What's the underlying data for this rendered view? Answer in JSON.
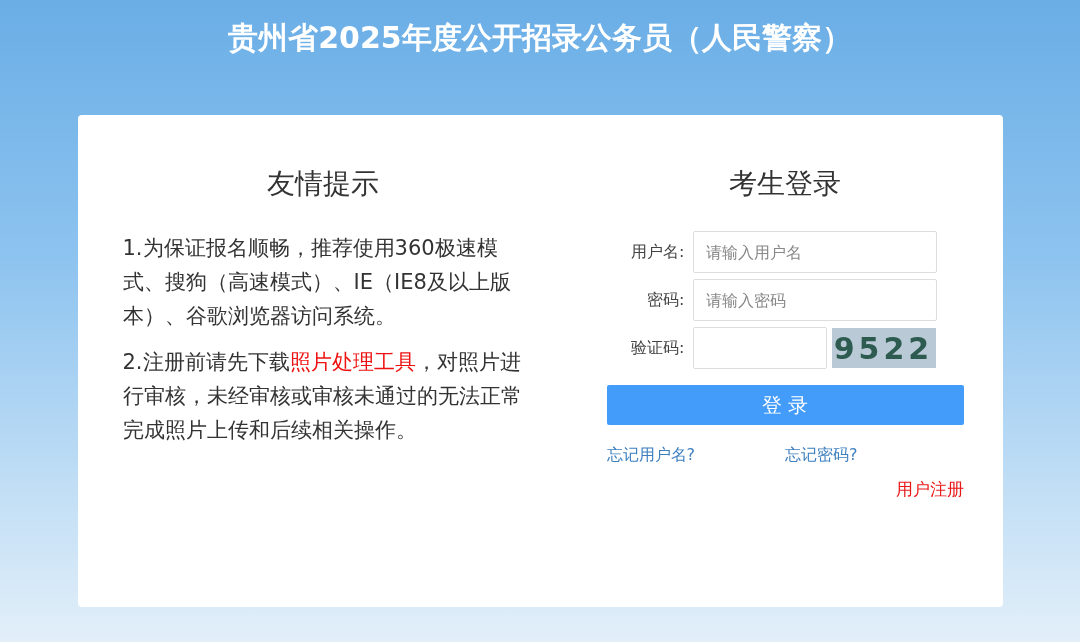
{
  "page_title": "贵州省2025年度公开招录公务员（人民警察）",
  "notice": {
    "heading": "友情提示",
    "paragraphs": [
      {
        "text": "1.为保证报名顺畅，推荐使用360极速模式、搜狗（高速模式）、IE（IE8及以上版本）、谷歌浏览器访问系统。"
      },
      {
        "text": "2.注册前请先下载",
        "link": "照片处理工具",
        "after": "，对照片进行审核，未经审核或审核未通过的无法正常完成照片上传和后续相关操作。"
      }
    ]
  },
  "login": {
    "heading": "考生登录",
    "fields": [
      {
        "kind": "text",
        "label": "用户名:",
        "placeholder": "请输入用户名"
      },
      {
        "kind": "password",
        "label": "密码:",
        "placeholder": "请输入密码"
      },
      {
        "kind": "captcha",
        "label": "验证码:",
        "captcha": "9522"
      }
    ],
    "submit": "登 录",
    "links": [
      "忘记用户名?",
      "忘记密码?"
    ],
    "register": "用户注册"
  }
}
